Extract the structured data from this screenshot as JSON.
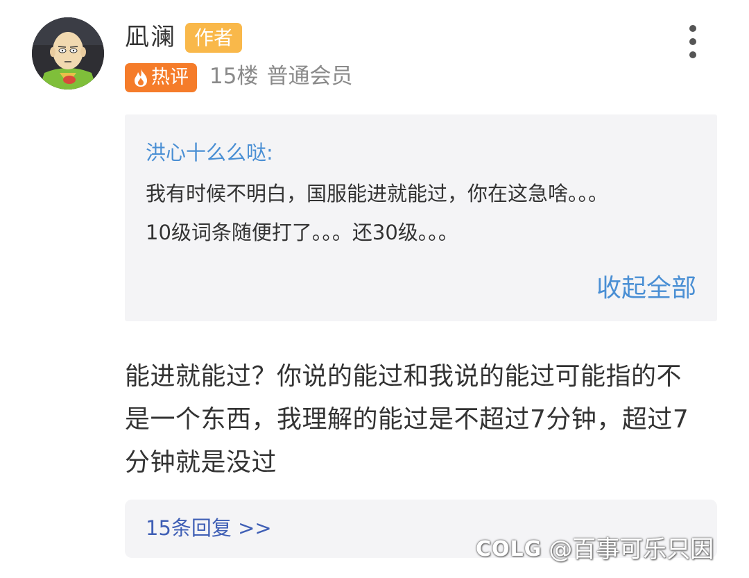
{
  "post": {
    "username": "凪澜",
    "author_badge": "作者",
    "hot_badge": "热评",
    "floor": "15楼",
    "member_level": "普通会员",
    "more_icon": "more-vertical-icon"
  },
  "quote": {
    "author": "洪心十么么哒:",
    "lines": [
      "我有时候不明白，国服能进就能过，你在这急啥。。。",
      "10级词条随便打了。。。还30级。。。"
    ],
    "collapse_label": "收起全部"
  },
  "comment": {
    "lines": [
      "能进就能过？你说的能过和我说的能过可能指的不",
      "是一个东西，我理解的能过是不超过7分钟，超过7",
      "分钟就是没过"
    ]
  },
  "replies": {
    "label": "15条回复 >>"
  },
  "watermark": {
    "logo": "COLG",
    "text": "@百事可乐只因"
  },
  "colors": {
    "author_badge": "#f9b84a",
    "hot_badge": "#f57c2a",
    "link_blue": "#4a8fd4",
    "reply_blue": "#3f5fb5",
    "quote_bg": "#f4f4f6"
  }
}
